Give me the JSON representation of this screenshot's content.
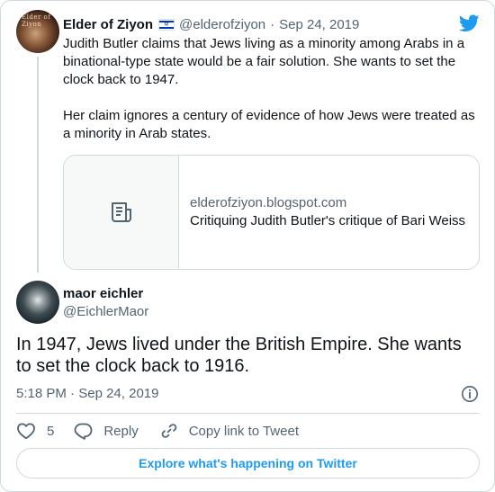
{
  "parent_tweet": {
    "avatar_text": "Elder of Ziyon",
    "author_name": "Elder of Ziyon",
    "author_handle": "@elderofziyon",
    "separator": "·",
    "date": "Sep 24, 2019",
    "paragraphs": [
      "Judith Butler claims that Jews living as a minority among Arabs in a binational-type state would be a fair solution. She wants to set the clock back to 1947.",
      "Her claim ignores a century of evidence of how Jews were treated as a minority in Arab states."
    ],
    "link_card": {
      "domain": "elderofziyon.blogspot.com",
      "title": "Critiquing Judith Butler's critique of Bari Weiss",
      "icon": "article-icon"
    }
  },
  "main_tweet": {
    "author_name": "maor eichler",
    "author_handle": "@EichlerMaor",
    "text": "In 1947, Jews lived under the British Empire. She wants to set the clock back to 1916.",
    "time": "5:18 PM",
    "separator": "·",
    "date": "Sep 24, 2019"
  },
  "actions": {
    "like_count": "5",
    "reply_label": "Reply",
    "copy_link_label": "Copy link to Tweet"
  },
  "footer": {
    "explore_label": "Explore what's happening on Twitter"
  },
  "icons": {
    "brand": "twitter-bird-icon",
    "flag": "israel-flag-icon",
    "info": "info-icon",
    "like": "heart-icon",
    "reply": "reply-icon",
    "copy_link": "link-icon"
  },
  "colors": {
    "accent": "#1d9bf0",
    "text_primary": "#0f1419",
    "text_secondary": "#536471",
    "border": "#cfd9de"
  }
}
